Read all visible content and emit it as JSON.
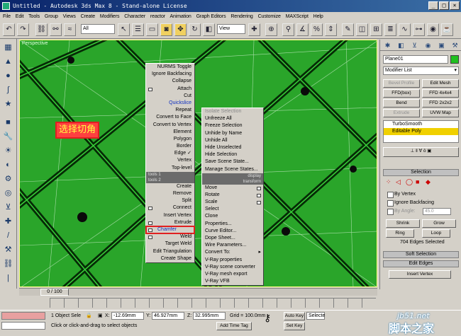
{
  "window": {
    "title": "Untitled  - Autodesk 3ds Max 8  - Stand-alone License"
  },
  "menubar": [
    "File",
    "Edit",
    "Tools",
    "Group",
    "Views",
    "Create",
    "Modifiers",
    "Character",
    "reactor",
    "Animation",
    "Graph Editors",
    "Rendering",
    "Customize",
    "MAXScript",
    "Help"
  ],
  "toolbar": {
    "selection_filter": "All",
    "ref_coord": "View"
  },
  "viewport": {
    "label": "Perspective"
  },
  "annotation": {
    "text": "选择切角"
  },
  "quad_left": {
    "items": [
      "NURMS Toggle",
      "Ignore Backfacing",
      "Collapse",
      "Attach",
      "Cut",
      "Quickslice",
      "Repeat",
      "Convert to Face",
      "Convert to Vertex",
      "Element",
      "Polygon",
      "Border",
      "Edge",
      "Vertex",
      "Top-level"
    ],
    "tools1": "tools 1",
    "tools2": "tools 2",
    "items2": [
      "Create",
      "Remove",
      "Split",
      "Connect",
      "Insert Vertex",
      "Extrude",
      "Chamfer",
      "Weld",
      "Target Weld",
      "Edit Triangulation",
      "Create Shape"
    ]
  },
  "quad_right": {
    "items": [
      "Isolate Selection",
      "Unfreeze All",
      "Freeze Selection",
      "Unhide by Name",
      "Unhide All",
      "Hide Unselected",
      "Hide Selection",
      "Save Scene State...",
      "Manage Scene States..."
    ],
    "display": "display",
    "transform": "transform",
    "items2": [
      "Move",
      "Rotate",
      "Scale",
      "Select",
      "Clone",
      "Properties...",
      "Curve Editor...",
      "Dope Sheet...",
      "Wire Parameters...",
      "Convert To:",
      "V-Ray properties",
      "V-Ray scene converter",
      "V-Ray mesh export",
      "V-Ray VFB"
    ]
  },
  "cmdpanel": {
    "object_name": "Plane01",
    "modifier_list": "Modifier List",
    "buttons": [
      "Bevel Profile",
      "Edit Mesh",
      "FFD(box)",
      "FFD 4x4x4",
      "Bend",
      "FFD 2x2x2",
      "Extrude",
      "UVW Map"
    ],
    "stack": [
      "TurboSmooth",
      "Editable Poly"
    ],
    "selection_rollout": "Selection",
    "by_vertex": "By Vertex",
    "ignore_backfacing": "Ignore Backfacing",
    "by_angle": "By Angle:",
    "angle_value": "45.0",
    "shrink": "Shrink",
    "grow": "Grow",
    "ring": "Ring",
    "loop": "Loop",
    "selected_info": "704 Edges Selected",
    "soft_selection": "Soft Selection",
    "edit_edges": "Edit Edges",
    "insert_vertex": "Insert Vertex"
  },
  "timeline": {
    "frame": "0 / 100"
  },
  "status": {
    "selected": "1 Object Sele",
    "x": "-12.69mm",
    "y": "46.927mm",
    "z": "32.995mm",
    "grid": "Grid = 100.0mm",
    "autokey": "Auto Key",
    "selected_dd": "Selecte",
    "setkey": "Set Key",
    "prompt": "Click or click-and-drag to select objects",
    "add_time_tag": "Add Time Tag"
  },
  "watermark": {
    "line1": "jb51.net",
    "line2": "脚本之家"
  }
}
